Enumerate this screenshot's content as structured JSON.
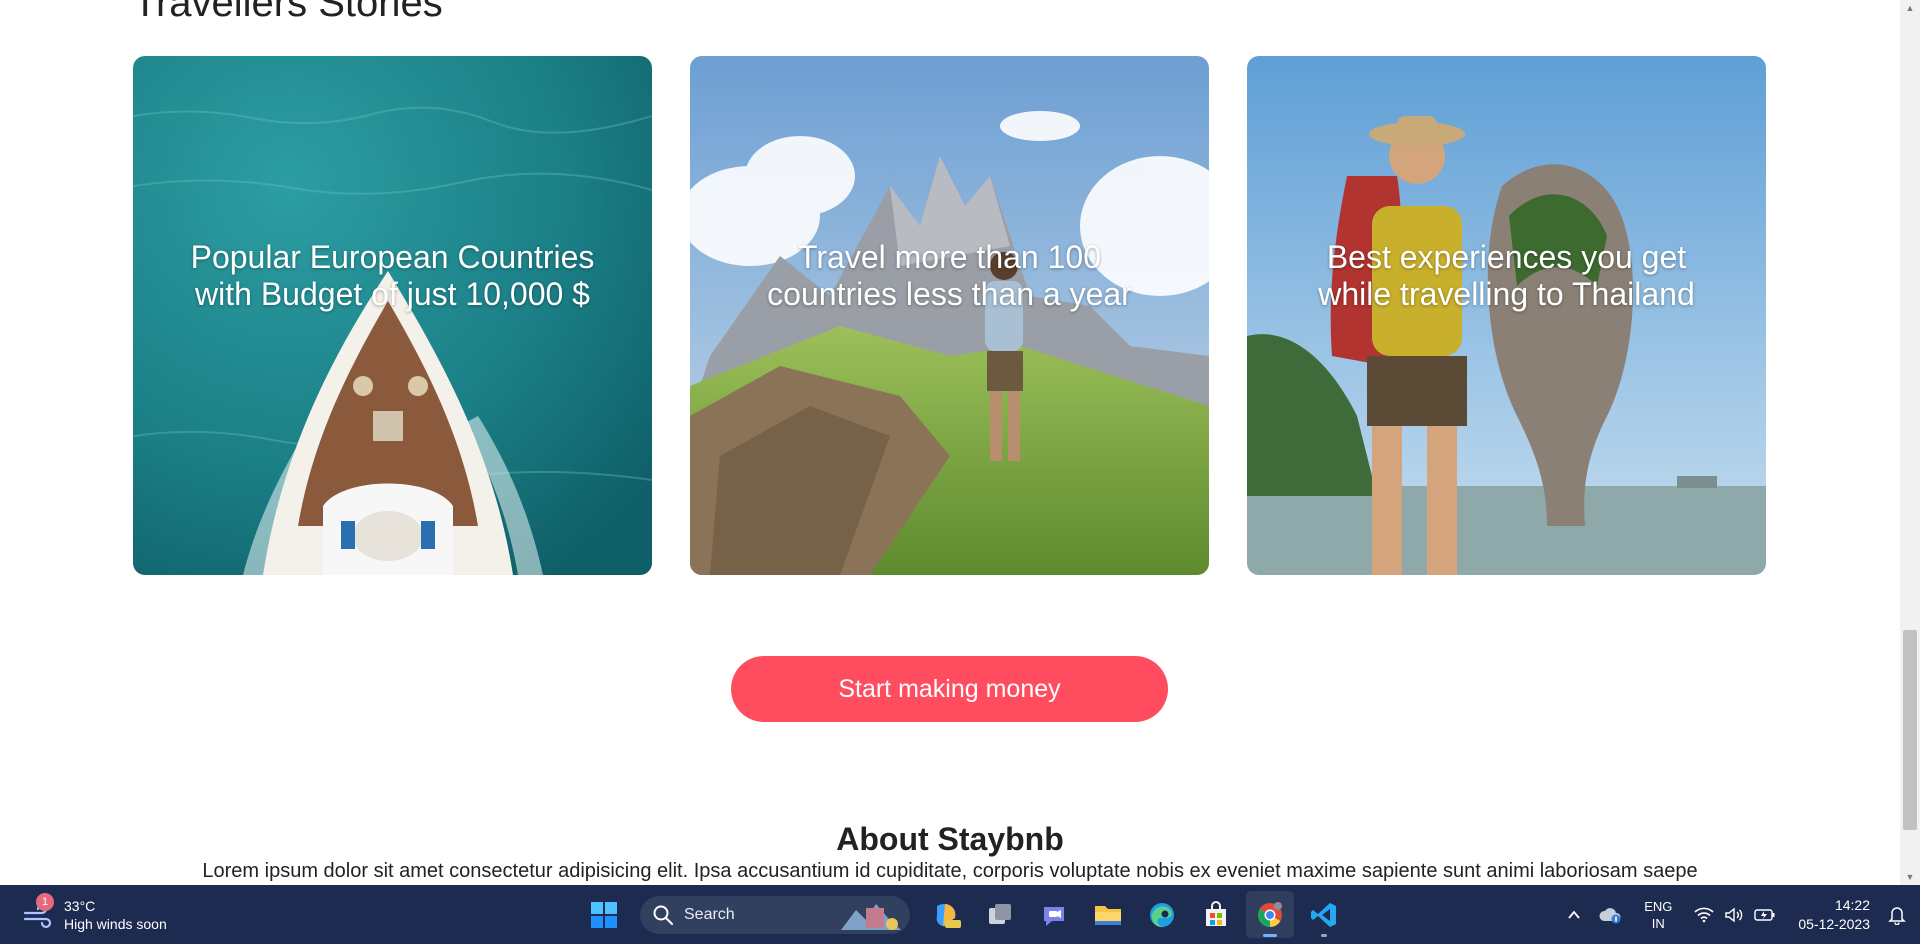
{
  "section": {
    "title": "Travellers Stories"
  },
  "cards": [
    {
      "title": "Popular European Countries with Budget of just 10,000 $"
    },
    {
      "title": "Travel more than 100 countries less than a year"
    },
    {
      "title": "Best experiences you get while travelling to Thailand"
    }
  ],
  "cta": {
    "label": "Start making money"
  },
  "about": {
    "title": "About Staybnb",
    "text": "Lorem ipsum dolor sit amet consectetur adipisicing elit. Ipsa accusantium id cupiditate, corporis voluptate nobis ex eveniet maxime sapiente sunt animi laboriosam saepe"
  },
  "colors": {
    "accent": "#ff4d5f",
    "taskbar": "#1c2b4f"
  },
  "taskbar": {
    "weather": {
      "temp": "33°C",
      "condition": "High winds soon",
      "badge": "1"
    },
    "search": {
      "label": "Search"
    },
    "apps": [
      "start-icon",
      "copilot-preview-icon",
      "task-view-icon",
      "teams-chat-icon",
      "file-explorer-icon",
      "edge-icon",
      "store-icon",
      "chrome-icon",
      "vscode-icon"
    ],
    "language": {
      "line1": "ENG",
      "line2": "IN"
    },
    "clock": {
      "time": "14:22",
      "date": "05-12-2023"
    }
  }
}
